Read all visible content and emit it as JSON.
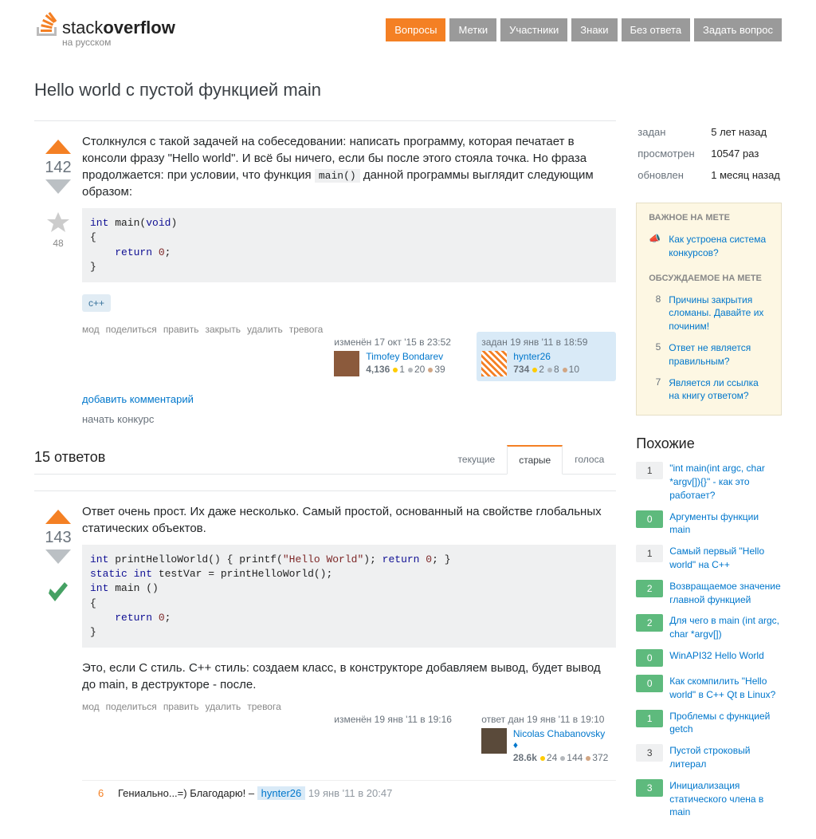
{
  "logo": {
    "text1": "stack",
    "text2": "overflow",
    "sub": "на русском"
  },
  "nav": [
    "Вопросы",
    "Метки",
    "Участники",
    "Знаки",
    "Без ответа",
    "Задать вопрос"
  ],
  "title": "Hello world с пустой функцией main",
  "question": {
    "score": "142",
    "favs": "48",
    "text1": "Столкнулся с такой задачей на собеседовании: написать программу, которая печатает в консоли фразу \"Hello world\". И всё бы ничего, если бы после этого стояла точка. Но фраза продолжается: при условии, что функция ",
    "inlineCode": "main()",
    "text2": " данной программы выглядит следующим образом:",
    "code": {
      "l1a": "int",
      "l1b": " main(",
      "l1c": "void",
      "l1d": ")",
      "l2": "{",
      "l3a": "    ",
      "l3b": "return",
      "l3c": " ",
      "l3d": "0",
      "l3e": ";",
      "l4": "}"
    },
    "tag": "c++",
    "menu": [
      "мод",
      "поделиться",
      "править",
      "закрыть",
      "удалить",
      "тревога"
    ],
    "editor": {
      "action": "изменён 17 окт '15 в 23:52",
      "name": "Timofey Bondarev",
      "rep": "4,136",
      "g": "1",
      "s": "20",
      "b": "39"
    },
    "owner": {
      "action": "задан 19 янв '11 в 18:59",
      "name": "hynter26",
      "rep": "734",
      "g": "2",
      "s": "8",
      "b": "10"
    },
    "addComment": "добавить комментарий",
    "bounty": "начать конкурс"
  },
  "answersCount": "15 ответов",
  "sortTabs": [
    "текущие",
    "старые",
    "голоса"
  ],
  "answer": {
    "score": "143",
    "text1": "Ответ очень прост. Их даже несколько. Самый простой, основанный на свойстве глобальных статических объектов.",
    "code": {
      "l1a": "int",
      "l1b": " printHelloWorld() { printf(",
      "l1c": "\"Hello World\"",
      "l1d": "); ",
      "l1e": "return",
      "l1f": " ",
      "l1g": "0",
      "l1h": "; }",
      "l2a": "static",
      "l2b": " ",
      "l2c": "int",
      "l2d": " testVar = printHelloWorld();",
      "l3a": "int",
      "l3b": " main ()",
      "l4": "{",
      "l5a": "    ",
      "l5b": "return",
      "l5c": " ",
      "l5d": "0",
      "l5e": ";",
      "l6": "}"
    },
    "text2": "Это, если С стиль. С++ стиль: создаем класс, в конструкторе добавляем вывод, будет вывод до main, в деструкторе - после.",
    "menu": [
      "мод",
      "поделиться",
      "править",
      "удалить",
      "тревога"
    ],
    "editor": {
      "action": "изменён 19 янв '11 в 19:16"
    },
    "owner": {
      "action": "ответ дан 19 янв '11 в 19:10",
      "name": "Nicolas Chabanovsky",
      "rep": "28.6k",
      "g": "24",
      "s": "144",
      "b": "372"
    },
    "comment": {
      "score": "6",
      "text": "Гениально...=) Благодарю! – ",
      "user": "hynter26",
      "date": " 19 янв '11 в 20:47"
    }
  },
  "info": {
    "askedL": "задан",
    "askedV": "5 лет назад",
    "viewedL": "просмотрен",
    "viewedV": "10547 раз",
    "activeL": "обновлен",
    "activeV": "1 месяц назад"
  },
  "meta": {
    "head1": "ВАЖНОЕ НА МЕТЕ",
    "featured": {
      "text": "Как устроена система конкурсов?"
    },
    "head2": "ОБСУЖДАЕМОЕ НА МЕТЕ",
    "items": [
      {
        "n": "8",
        "t": "Причины закрытия сломаны. Давайте их починим!"
      },
      {
        "n": "5",
        "t": "Ответ не является правильным?"
      },
      {
        "n": "7",
        "t": "Является ли ссылка на книгу ответом?"
      }
    ]
  },
  "related": {
    "head": "Похожие",
    "items": [
      {
        "n": "1",
        "a": false,
        "t": "\"int main(int argc, char *argv[]){}\" - как это работает?"
      },
      {
        "n": "0",
        "a": true,
        "t": "Аргументы функции main"
      },
      {
        "n": "1",
        "a": false,
        "t": "Самый первый \"Hello world\" на C++"
      },
      {
        "n": "2",
        "a": true,
        "t": "Возвращаемое значение главной функцией"
      },
      {
        "n": "2",
        "a": true,
        "t": "Для чего в main (int argc, char *argv[])"
      },
      {
        "n": "0",
        "a": true,
        "t": "WinAPI32 Hello World"
      },
      {
        "n": "0",
        "a": true,
        "t": "Как скомпилить \"Hello world\" в С++ Qt в Linux?"
      },
      {
        "n": "1",
        "a": true,
        "t": "Проблемы с функцией getch"
      },
      {
        "n": "3",
        "a": false,
        "t": "Пустой строковый литерал"
      },
      {
        "n": "3",
        "a": true,
        "t": "Инициализация статического члена в main"
      }
    ]
  }
}
